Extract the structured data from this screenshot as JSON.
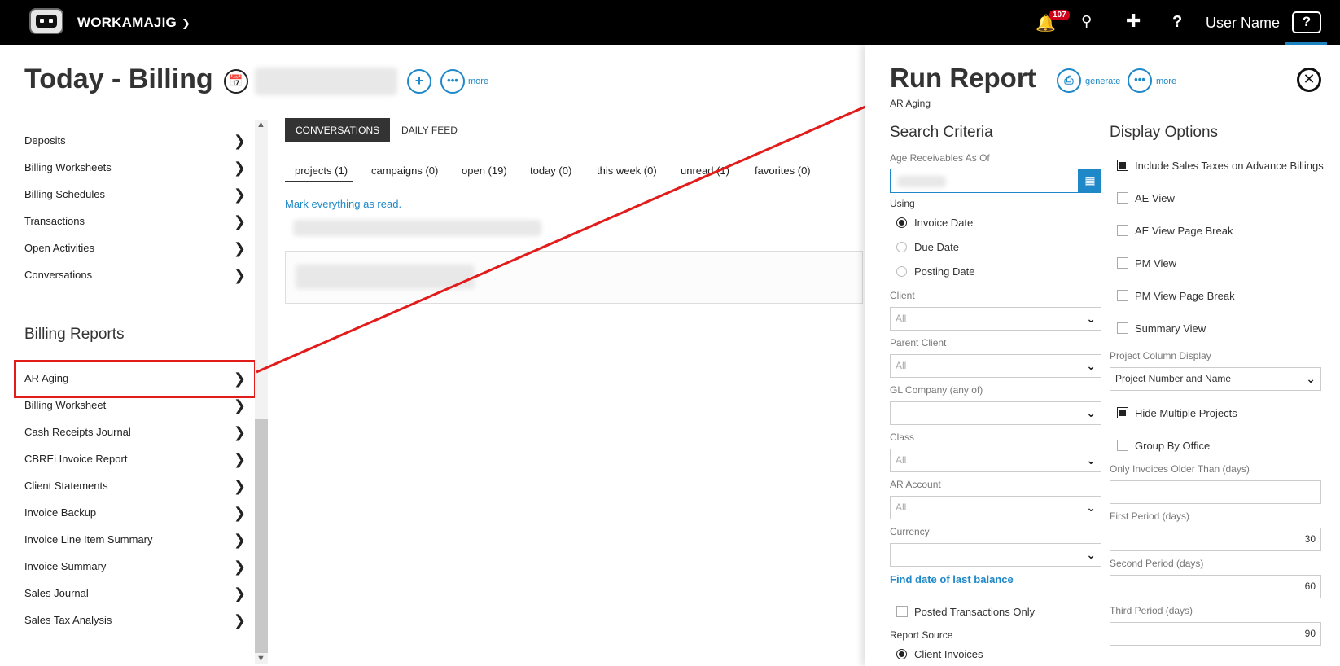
{
  "topbar": {
    "brand": "WORKAMAJIG",
    "notification_count": "107",
    "user_name": "User Name",
    "help_label": "?"
  },
  "page": {
    "title": "Today - Billing",
    "more_label": "more"
  },
  "sidebar": {
    "items": [
      {
        "label": "Deposits"
      },
      {
        "label": "Billing Worksheets"
      },
      {
        "label": "Billing Schedules"
      },
      {
        "label": "Transactions"
      },
      {
        "label": "Open Activities"
      },
      {
        "label": "Conversations"
      }
    ],
    "reports_title": "Billing Reports",
    "reports": [
      {
        "label": "AR Aging"
      },
      {
        "label": "Billing Worksheet"
      },
      {
        "label": "Cash Receipts Journal"
      },
      {
        "label": "CBREi Invoice Report"
      },
      {
        "label": "Client Statements"
      },
      {
        "label": "Invoice Backup"
      },
      {
        "label": "Invoice Line Item Summary"
      },
      {
        "label": "Invoice Summary"
      },
      {
        "label": "Sales Journal"
      },
      {
        "label": "Sales Tax Analysis"
      }
    ]
  },
  "main": {
    "tabs": [
      {
        "label": "CONVERSATIONS"
      },
      {
        "label": "DAILY FEED"
      }
    ],
    "filters": [
      {
        "label": "projects (1)"
      },
      {
        "label": "campaigns (0)"
      },
      {
        "label": "open (19)"
      },
      {
        "label": "today (0)"
      },
      {
        "label": "this week (0)"
      },
      {
        "label": "unread (1)"
      },
      {
        "label": "favorites (0)"
      }
    ],
    "mark_read": "Mark everything as read."
  },
  "panel": {
    "title": "Run Report",
    "subtitle": "AR Aging",
    "generate_label": "generate",
    "more_label": "more",
    "search_criteria": {
      "title": "Search Criteria",
      "age_label": "Age Receivables As Of",
      "using_label": "Using",
      "using_options": [
        {
          "label": "Invoice Date",
          "selected": true
        },
        {
          "label": "Due Date",
          "selected": false
        },
        {
          "label": "Posting Date",
          "selected": false
        }
      ],
      "fields": [
        {
          "label": "Client",
          "value": "All"
        },
        {
          "label": "Parent Client",
          "value": "All"
        },
        {
          "label": "GL Company (any of)",
          "value": ""
        },
        {
          "label": "Class",
          "value": "All"
        },
        {
          "label": "AR Account",
          "value": "All"
        },
        {
          "label": "Currency",
          "value": ""
        }
      ],
      "find_link": "Find date of last balance",
      "posted_only": "Posted Transactions Only",
      "report_source_label": "Report Source",
      "report_source_option": "Client Invoices"
    },
    "display_options": {
      "title": "Display Options",
      "checks": [
        {
          "label": "Include Sales Taxes on Advance Billings",
          "checked": true
        },
        {
          "label": "AE View",
          "checked": false
        },
        {
          "label": "AE View Page Break",
          "checked": false
        },
        {
          "label": "PM View",
          "checked": false
        },
        {
          "label": "PM View Page Break",
          "checked": false
        },
        {
          "label": "Summary View",
          "checked": false
        }
      ],
      "project_column_label": "Project Column Display",
      "project_column_value": "Project Number and Name",
      "hide_multiple": "Hide Multiple Projects",
      "group_by_office": "Group By Office",
      "older_than_label": "Only Invoices Older Than (days)",
      "older_than_value": "",
      "first_label": "First Period (days)",
      "first_value": "30",
      "second_label": "Second Period (days)",
      "second_value": "60",
      "third_label": "Third Period (days)",
      "third_value": "90"
    }
  }
}
